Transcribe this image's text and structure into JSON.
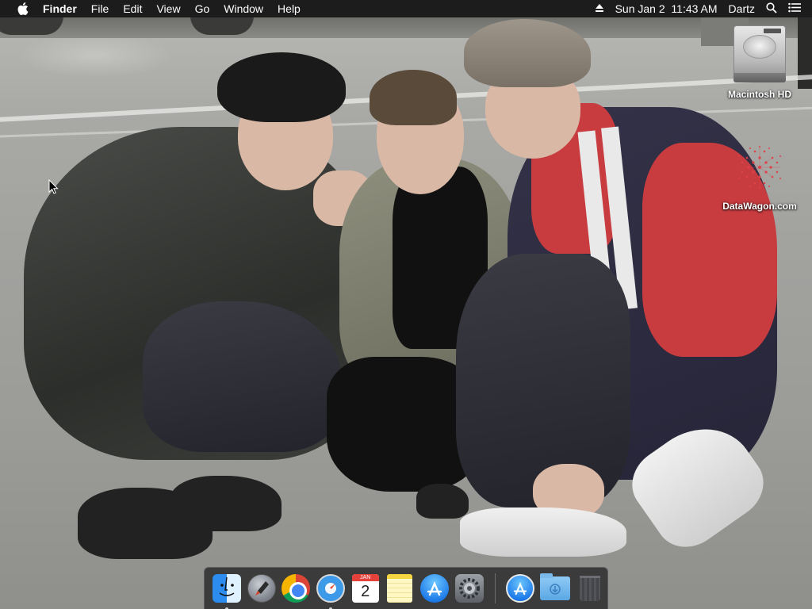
{
  "menubar": {
    "apple_icon": "apple-icon",
    "items": [
      {
        "label": "Finder",
        "bold": true
      },
      {
        "label": "File"
      },
      {
        "label": "Edit"
      },
      {
        "label": "View"
      },
      {
        "label": "Go"
      },
      {
        "label": "Window"
      },
      {
        "label": "Help"
      }
    ],
    "status": {
      "eject_icon": "eject-icon",
      "clock": "Sun Jan 2  11:43 AM",
      "user": "Dartz",
      "search_icon": "spotlight-search-icon",
      "notification_icon": "notification-center-icon"
    }
  },
  "desktop": {
    "icons": [
      {
        "label": "Macintosh HD",
        "icon": "hard-drive-icon"
      },
      {
        "label": "DataWagon.com",
        "icon": "datawagon-logo-icon"
      }
    ]
  },
  "dock": {
    "apps": [
      {
        "name": "Finder",
        "icon": "finder-icon",
        "running": true
      },
      {
        "name": "Launchpad",
        "icon": "launchpad-icon",
        "running": false
      },
      {
        "name": "Google Chrome",
        "icon": "chrome-icon",
        "running": false
      },
      {
        "name": "Safari",
        "icon": "safari-icon",
        "running": true
      },
      {
        "name": "Calendar",
        "icon": "calendar-icon",
        "running": false,
        "month": "JAN",
        "day": "2"
      },
      {
        "name": "Notes",
        "icon": "notes-icon",
        "running": false
      },
      {
        "name": "App Store",
        "icon": "app-store-icon",
        "running": false
      },
      {
        "name": "System Preferences",
        "icon": "system-preferences-icon",
        "running": false
      }
    ],
    "others": [
      {
        "name": "Applications",
        "icon": "applications-folder-icon"
      },
      {
        "name": "Downloads",
        "icon": "downloads-folder-icon"
      },
      {
        "name": "Trash",
        "icon": "trash-icon"
      }
    ]
  },
  "colors": {
    "menubar_bg": "#1c1c1d",
    "dock_bg": "#28282a",
    "calendar_red": "#e3413a"
  }
}
